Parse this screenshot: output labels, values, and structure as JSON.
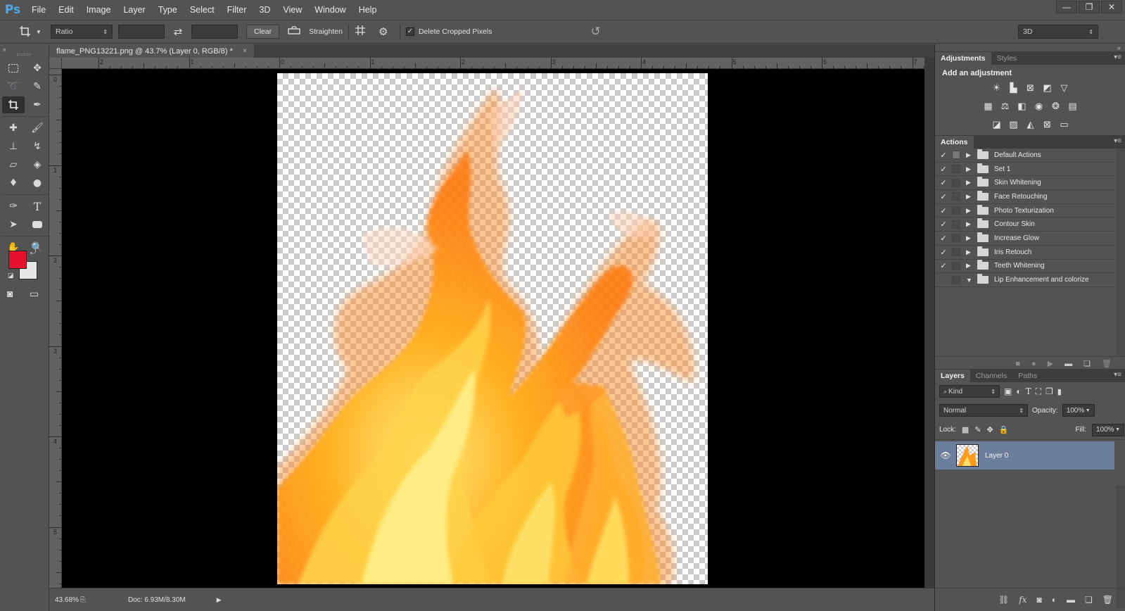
{
  "app": {
    "logo": "Ps",
    "menu": [
      "File",
      "Edit",
      "Image",
      "Layer",
      "Type",
      "Select",
      "Filter",
      "3D",
      "View",
      "Window",
      "Help"
    ],
    "window_controls": [
      "—",
      "❐",
      "✕"
    ]
  },
  "options_bar": {
    "ratio_select": "Ratio",
    "clear_label": "Clear",
    "straighten_label": "Straighten",
    "delete_cropped_label": "Delete Cropped Pixels",
    "delete_cropped_checked": true,
    "workspace_select": "3D"
  },
  "document": {
    "tab_title": "flame_PNG13221.png @ 43.7% (Layer 0, RGB/8) *",
    "close_glyph": "×"
  },
  "rulers": {
    "horizontal_labels": [
      "2",
      "1",
      "0",
      "1",
      "2",
      "3",
      "4",
      "5",
      "6",
      "7"
    ],
    "vertical_labels": [
      "0",
      "1",
      "2",
      "3",
      "4",
      "5"
    ]
  },
  "status": {
    "zoom": "43.68%",
    "doc_info": "Doc: 6.93M/8.30M"
  },
  "colors": {
    "foreground": "#e8112d",
    "background": "#e6e6e6",
    "selected_layer": "#6b7e9b"
  },
  "adjustments": {
    "tabs": [
      "Adjustments",
      "Styles"
    ],
    "title": "Add an adjustment",
    "icon_rows": [
      [
        "brightness-icon",
        "levels-icon",
        "curves-icon",
        "exposure-icon",
        "vibrance-icon"
      ],
      [
        "hue-saturation-icon",
        "color-balance-icon",
        "black-white-icon",
        "photo-filter-icon",
        "channel-mixer-icon",
        "color-lookup-icon"
      ],
      [
        "invert-icon",
        "posterize-icon",
        "threshold-icon",
        "selective-color-icon",
        "gradient-map-icon"
      ]
    ]
  },
  "actions": {
    "tab": "Actions",
    "items": [
      {
        "label": "Default Actions",
        "checked": true,
        "expanded": false
      },
      {
        "label": "Set 1",
        "checked": true,
        "expanded": false
      },
      {
        "label": "Skin Whitening",
        "checked": true,
        "expanded": false
      },
      {
        "label": "Face Retouching",
        "checked": true,
        "expanded": false
      },
      {
        "label": "Photo Texturization",
        "checked": true,
        "expanded": false
      },
      {
        "label": "Contour Skin",
        "checked": true,
        "expanded": false
      },
      {
        "label": "Increase Glow",
        "checked": true,
        "expanded": false
      },
      {
        "label": "Iris Retouch",
        "checked": true,
        "expanded": false
      },
      {
        "label": "Teeth Whitening",
        "checked": true,
        "expanded": false
      },
      {
        "label": "Lip Enhancement and colorize",
        "checked": false,
        "expanded": true
      }
    ]
  },
  "layers": {
    "tabs": [
      "Layers",
      "Channels",
      "Paths"
    ],
    "filter_kind": "Kind",
    "blend_mode": "Normal",
    "opacity_label": "Opacity:",
    "opacity_value": "100%",
    "lock_label": "Lock:",
    "fill_label": "Fill:",
    "fill_value": "100%",
    "items": [
      {
        "name": "Layer 0",
        "visible": true,
        "selected": true
      }
    ]
  }
}
